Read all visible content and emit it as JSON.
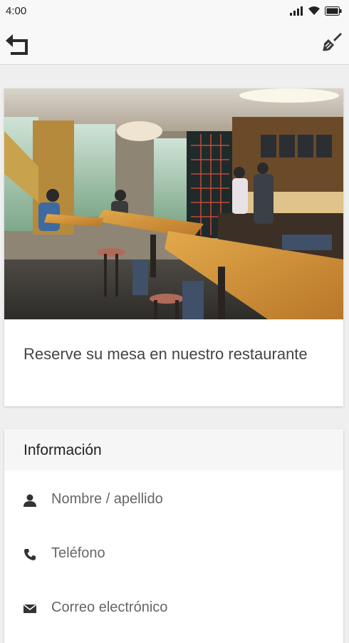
{
  "status_bar": {
    "time": "4:00",
    "icons": [
      "signal-icon",
      "wifi-icon",
      "battery-icon"
    ]
  },
  "toolbar": {
    "back_icon": "back-arrow-icon",
    "action_icon": "brush-icon"
  },
  "hero": {
    "image": "restaurant-interior-photo",
    "caption": "Reserve su mesa en nuestro restaurante"
  },
  "info": {
    "title": "Información",
    "fields": [
      {
        "icon": "person-icon",
        "placeholder": "Nombre / apellido"
      },
      {
        "icon": "phone-icon",
        "placeholder": "Teléfono"
      },
      {
        "icon": "envelope-icon",
        "placeholder": "Correo electrónico"
      }
    ]
  },
  "colors": {
    "background": "#efefef",
    "toolbar": "#f8f8f8",
    "card": "#ffffff",
    "text": "#444444"
  }
}
